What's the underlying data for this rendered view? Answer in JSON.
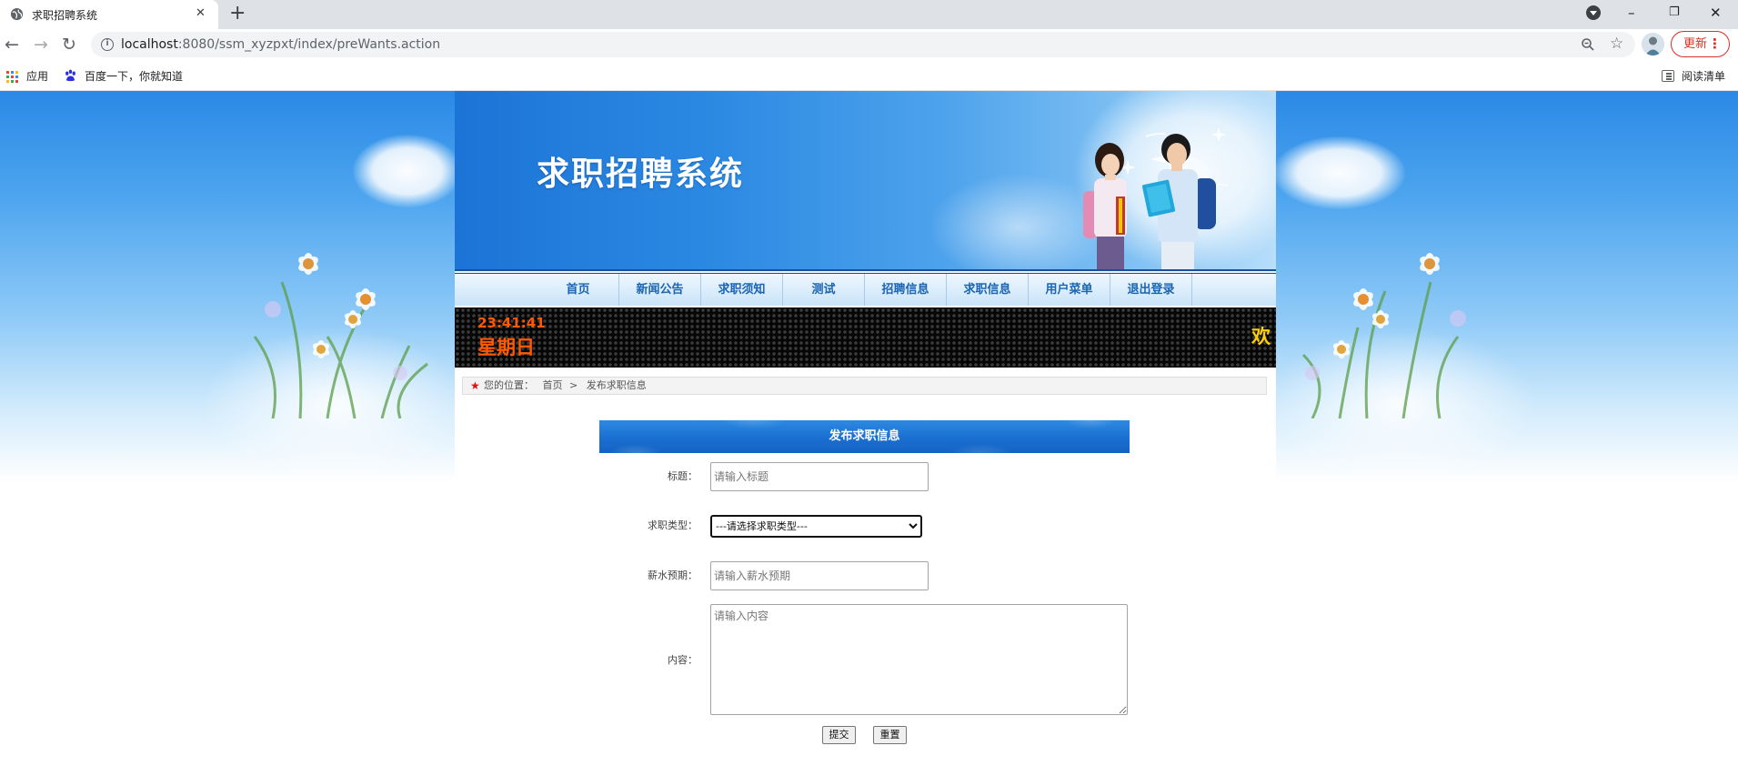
{
  "browser": {
    "tab_title": "求职招聘系统",
    "url_host": "localhost",
    "url_rest": ":8080/ssm_xyzpxt/index/preWants.action",
    "update_label": "更新",
    "bookmarks": [
      {
        "label": "应用"
      },
      {
        "label": "百度一下，你就知道"
      }
    ],
    "reading_list": "阅读清单",
    "icons": [
      "globe-icon",
      "close-tab-icon",
      "new-tab-icon",
      "tab-search-icon",
      "minimize-icon",
      "restore-icon",
      "close-window-icon",
      "back-arrow-icon",
      "forward-arrow-icon",
      "reload-icon",
      "site-info-icon",
      "zoom-icon",
      "bookmark-star-icon",
      "profile-avatar",
      "more-menu-icon",
      "apps-grid-icon",
      "baidu-paw-icon",
      "reading-list-icon"
    ]
  },
  "site": {
    "title": "求职招聘系统",
    "nav": [
      "首页",
      "新闻公告",
      "求职须知",
      "测试",
      "招聘信息",
      "求职信息",
      "用户菜单",
      "退出登录"
    ],
    "clock": {
      "time": "23:41:41",
      "weekday": "星期日"
    },
    "marquee": "欢",
    "breadcrumb": {
      "prefix": "您的位置：",
      "home": "首页",
      "separator": ">",
      "current": "发布求职信息"
    }
  },
  "form": {
    "heading": "发布求职信息",
    "fields": {
      "title": {
        "label": "标题：",
        "placeholder": "请输入标题"
      },
      "type": {
        "label": "求职类型：",
        "selected": "---请选择求职类型---"
      },
      "salary": {
        "label": "薪水预期：",
        "placeholder": "请输入薪水预期"
      },
      "content": {
        "label": "内容：",
        "placeholder": "请输入内容"
      }
    },
    "submit": "提交",
    "reset": "重置"
  },
  "colors": {
    "banner_blue": "#1c74d6",
    "nav_text": "#1b64b4",
    "led_clock": "#ff5a00",
    "led_marquee": "#ffd000",
    "breadcrumb_star": "#e01010",
    "update_red": "#d93025"
  }
}
